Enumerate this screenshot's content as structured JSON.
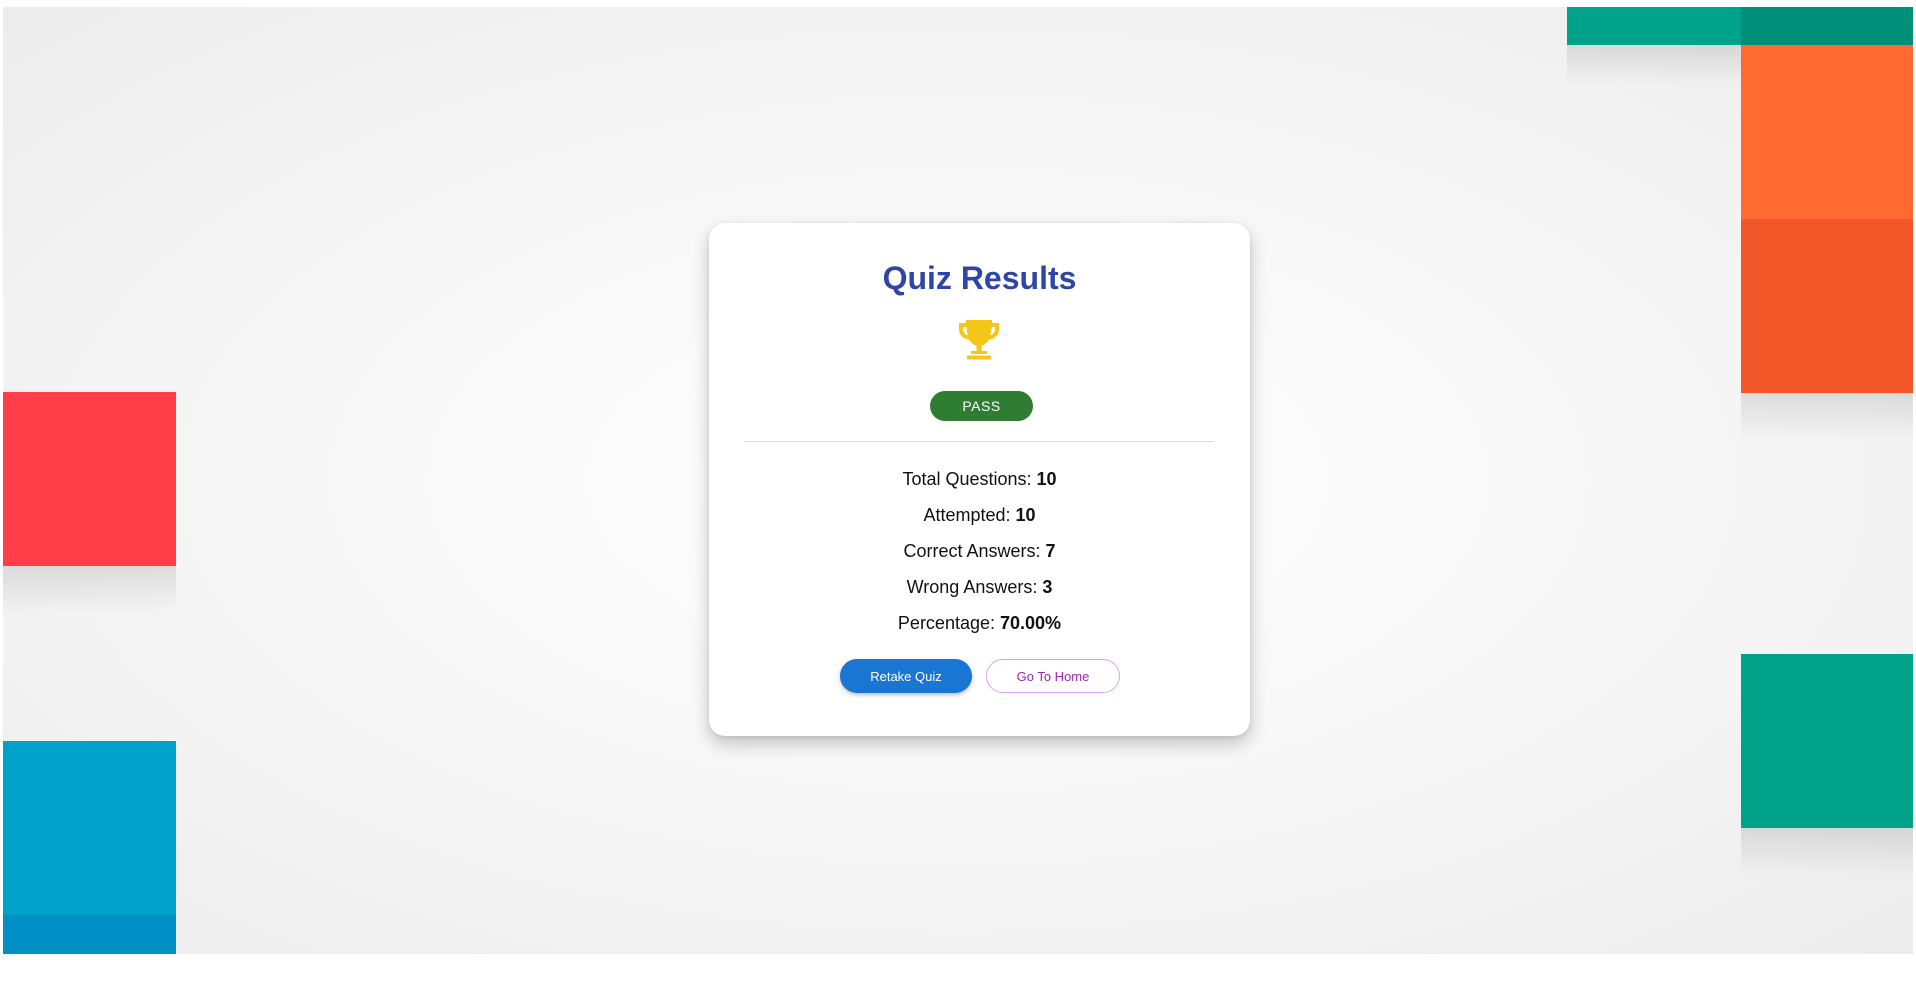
{
  "card": {
    "title": "Quiz Results",
    "trophy_icon": "trophy-icon",
    "status": "PASS",
    "stats": [
      {
        "label": "Total Questions: ",
        "value": "10"
      },
      {
        "label": "Attempted: ",
        "value": "10"
      },
      {
        "label": "Correct Answers: ",
        "value": "7"
      },
      {
        "label": "Wrong Answers: ",
        "value": "3"
      },
      {
        "label": "Percentage: ",
        "value": "70.00%"
      }
    ],
    "buttons": {
      "retake_label": "Retake Quiz",
      "home_label": "Go To Home"
    }
  },
  "colors": {
    "title": "#3045a8",
    "trophy": "#f5c518",
    "pass_badge": "#2e7d32",
    "primary_button": "#1976d2",
    "outline_button": "#9c27b0",
    "deco_teal": "#00a38a",
    "deco_orange": "#ff6a30",
    "deco_red_orange": "#f2572a",
    "deco_red": "#ff3e4a",
    "deco_blue": "#00a2c9"
  }
}
